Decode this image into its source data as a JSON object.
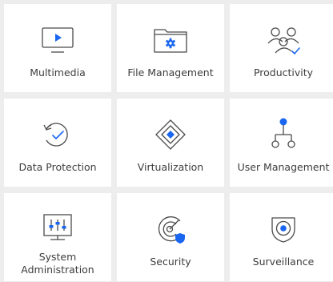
{
  "tiles": [
    {
      "label": "Multimedia",
      "icon": "monitor-play-icon"
    },
    {
      "label": "File Management",
      "icon": "folder-gear-icon"
    },
    {
      "label": "Productivity",
      "icon": "users-check-icon"
    },
    {
      "label": "Data Protection",
      "icon": "restore-check-icon"
    },
    {
      "label": "Virtualization",
      "icon": "nested-diamond-icon"
    },
    {
      "label": "User Management",
      "icon": "hierarchy-icon"
    },
    {
      "label_line1": "System",
      "label_line2": "Administration",
      "icon": "system-sliders-icon"
    },
    {
      "label": "Security",
      "icon": "radar-shield-icon"
    },
    {
      "label": "Surveillance",
      "icon": "camera-eye-icon"
    }
  ],
  "colors": {
    "accent": "#1a66f0",
    "stroke": "#4a4a4a",
    "tile_bg": "#ffffff",
    "page_bg": "#ededed"
  }
}
